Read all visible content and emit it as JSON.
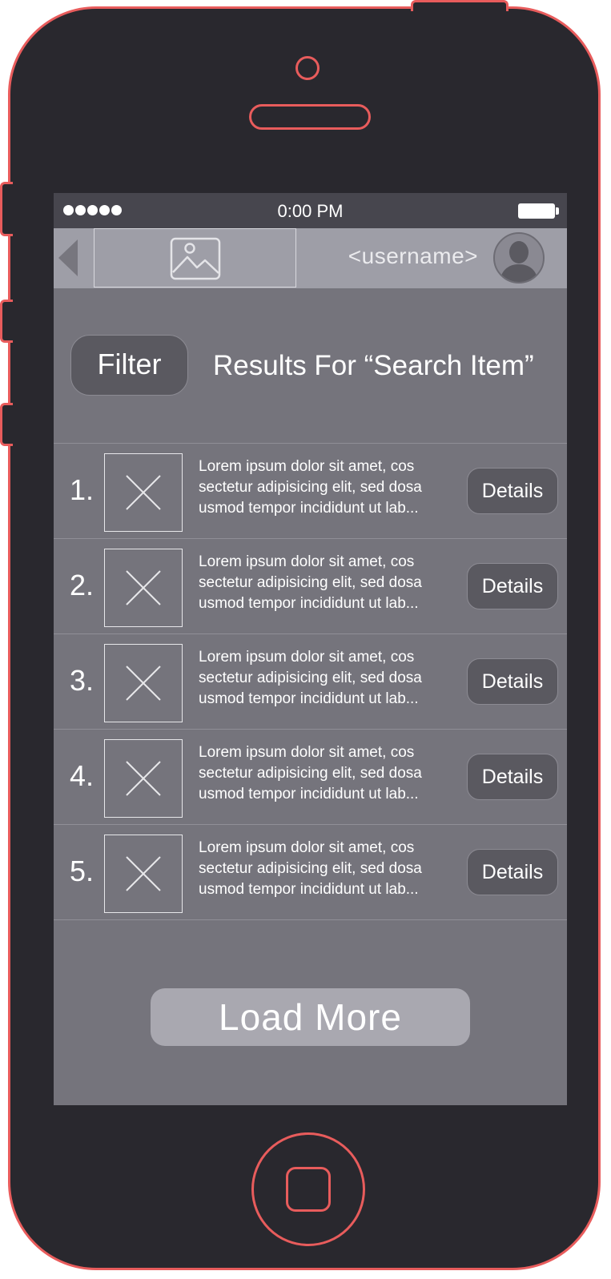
{
  "status_bar": {
    "signal_dots": 5,
    "time": "0:00 PM",
    "battery": "full"
  },
  "nav": {
    "back_icon": "back-arrow-icon",
    "logo_icon": "image-placeholder-icon",
    "username": "<username>",
    "avatar_icon": "user-avatar-icon"
  },
  "header": {
    "filter_label": "Filter",
    "results_title": "Results For “Search Item”"
  },
  "results": [
    {
      "number": "1.",
      "thumbnail_icon": "image-placeholder-x-icon",
      "text": "Lorem ipsum dolor sit amet, cos sectetur adipisicing elit, sed dosa usmod tempor incididunt ut lab...",
      "details_label": "Details"
    },
    {
      "number": "2.",
      "thumbnail_icon": "image-placeholder-x-icon",
      "text": "Lorem ipsum dolor sit amet, cos sectetur adipisicing elit, sed dosa usmod tempor incididunt ut lab...",
      "details_label": "Details"
    },
    {
      "number": "3.",
      "thumbnail_icon": "image-placeholder-x-icon",
      "text": "Lorem ipsum dolor sit amet, cos sectetur adipisicing elit, sed dosa usmod tempor incididunt ut lab...",
      "details_label": "Details"
    },
    {
      "number": "4.",
      "thumbnail_icon": "image-placeholder-x-icon",
      "text": "Lorem ipsum dolor sit amet, cos sectetur adipisicing elit, sed dosa usmod tempor incididunt ut lab...",
      "details_label": "Details"
    },
    {
      "number": "5.",
      "thumbnail_icon": "image-placeholder-x-icon",
      "text": "Lorem ipsum dolor sit amet, cos sectetur adipisicing elit, sed dosa usmod tempor incididunt ut lab...",
      "details_label": "Details"
    }
  ],
  "load_more_label": "Load More",
  "colors": {
    "phone_outline": "#e85c5c",
    "phone_body": "#29282e",
    "screen_bg": "#75747c",
    "status_bar_bg": "#47464e",
    "nav_bar_bg": "#9e9ea7",
    "button_bg": "#5a5960",
    "load_more_bg": "#a9a8b0"
  }
}
